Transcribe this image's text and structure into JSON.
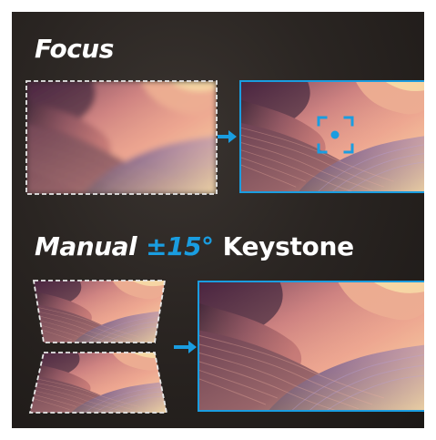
{
  "focus": {
    "title": "Focus"
  },
  "keystone": {
    "manual": "Manual",
    "degree": "±15°",
    "label": "Keystone"
  },
  "colors": {
    "background": "#2a2522",
    "accent": "#1a9de0",
    "text": "#ffffff",
    "dashed_border": "#e8e8e8"
  },
  "icons": {
    "focus_reticle": "focus-reticle-icon",
    "arrow": "arrow-right-icon"
  }
}
